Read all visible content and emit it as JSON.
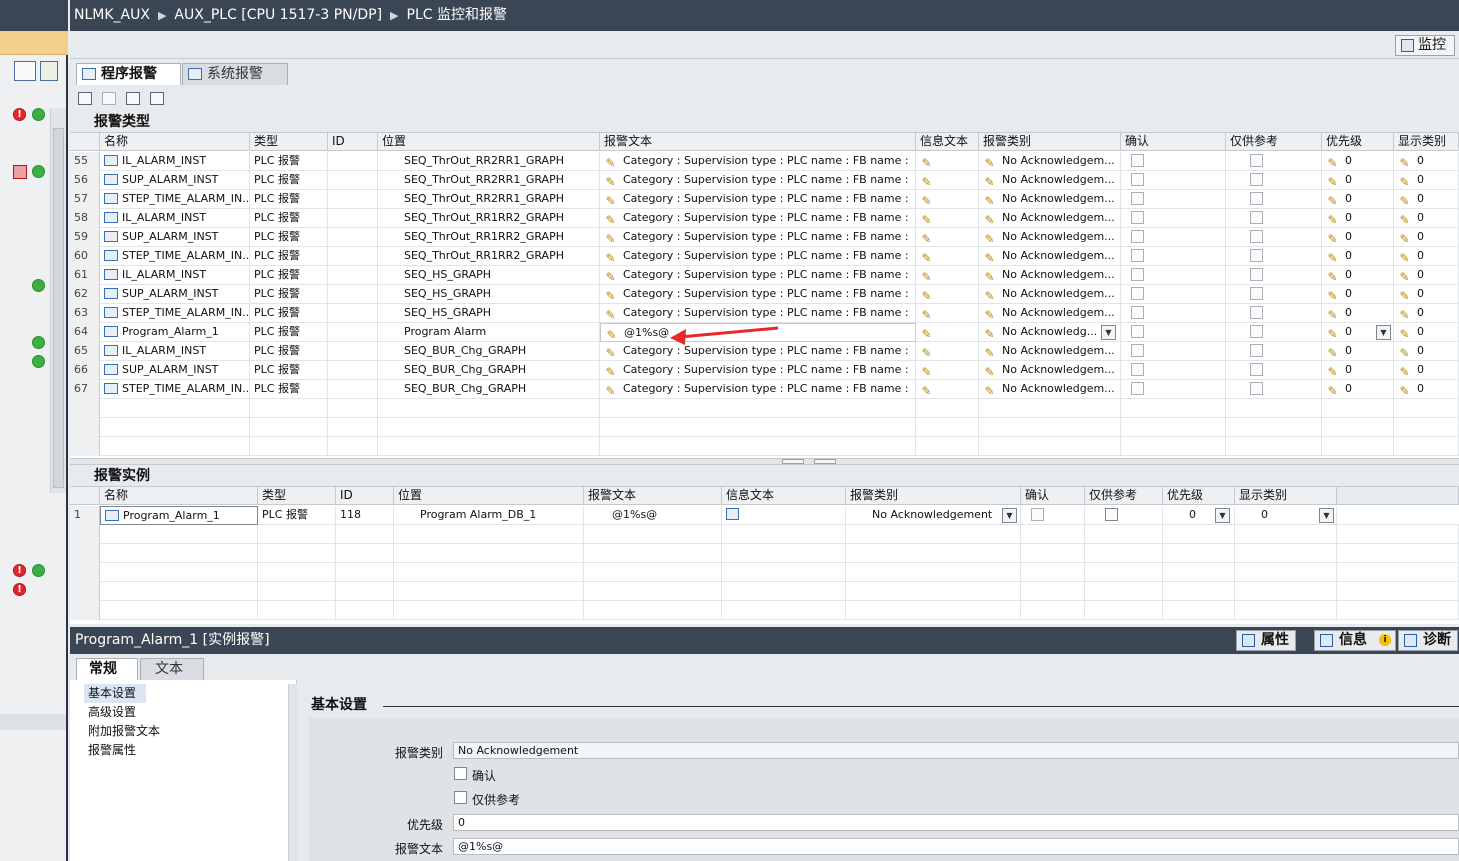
{
  "breadcrumb": {
    "project": "NLMK_AUX",
    "device": "AUX_PLC [CPU 1517-3 PN/DP]",
    "page": "PLC 监控和报警"
  },
  "toolbar": {
    "monitor_label": "监控"
  },
  "tabs": {
    "program_alarms": "程序报警",
    "system_alarms": "系统报警"
  },
  "alarm_types": {
    "section_title": "报警类型",
    "columns": [
      "名称",
      "类型",
      "ID",
      "位置",
      "报警文本",
      "信息文本",
      "报警类别",
      "确认",
      "仅供参考",
      "优先级",
      "显示类别"
    ],
    "rows": [
      {
        "n": "55",
        "name": "IL_ALARM_INST",
        "type": "PLC 报警",
        "loc": "SEQ_ThrOut_RR2RR1_GRAPH",
        "text": "Category : Supervision type : PLC name : FB name :",
        "cls": "No Acknowledgem...",
        "prio": "0",
        "disp": "0"
      },
      {
        "n": "56",
        "name": "SUP_ALARM_INST",
        "type": "PLC 报警",
        "loc": "SEQ_ThrOut_RR2RR1_GRAPH",
        "text": "Category : Supervision type : PLC name : FB name :",
        "cls": "No Acknowledgem...",
        "prio": "0",
        "disp": "0"
      },
      {
        "n": "57",
        "name": "STEP_TIME_ALARM_IN...",
        "type": "PLC 报警",
        "loc": "SEQ_ThrOut_RR2RR1_GRAPH",
        "text": "Category : Supervision type : PLC name : FB name :",
        "cls": "No Acknowledgem...",
        "prio": "0",
        "disp": "0"
      },
      {
        "n": "58",
        "name": "IL_ALARM_INST",
        "type": "PLC 报警",
        "loc": "SEQ_ThrOut_RR1RR2_GRAPH",
        "text": "Category : Supervision type : PLC name : FB name :",
        "cls": "No Acknowledgem...",
        "prio": "0",
        "disp": "0"
      },
      {
        "n": "59",
        "name": "SUP_ALARM_INST",
        "type": "PLC 报警",
        "loc": "SEQ_ThrOut_RR1RR2_GRAPH",
        "text": "Category : Supervision type : PLC name : FB name :",
        "cls": "No Acknowledgem...",
        "prio": "0",
        "disp": "0"
      },
      {
        "n": "60",
        "name": "STEP_TIME_ALARM_IN...",
        "type": "PLC 报警",
        "loc": "SEQ_ThrOut_RR1RR2_GRAPH",
        "text": "Category : Supervision type : PLC name : FB name :",
        "cls": "No Acknowledgem...",
        "prio": "0",
        "disp": "0"
      },
      {
        "n": "61",
        "name": "IL_ALARM_INST",
        "type": "PLC 报警",
        "loc": "SEQ_HS_GRAPH",
        "text": "Category : Supervision type : PLC name : FB name :",
        "cls": "No Acknowledgem...",
        "prio": "0",
        "disp": "0"
      },
      {
        "n": "62",
        "name": "SUP_ALARM_INST",
        "type": "PLC 报警",
        "loc": "SEQ_HS_GRAPH",
        "text": "Category : Supervision type : PLC name : FB name :",
        "cls": "No Acknowledgem...",
        "prio": "0",
        "disp": "0"
      },
      {
        "n": "63",
        "name": "STEP_TIME_ALARM_IN...",
        "type": "PLC 报警",
        "loc": "SEQ_HS_GRAPH",
        "text": "Category : Supervision type : PLC name : FB name :",
        "cls": "No Acknowledgem...",
        "prio": "0",
        "disp": "0"
      },
      {
        "n": "64",
        "name": "Program_Alarm_1",
        "type": "PLC 报警",
        "loc": "Program Alarm",
        "text": "@1%s@",
        "cls": "No Acknowledg...",
        "prio": "0",
        "disp": "0",
        "selected": true
      },
      {
        "n": "65",
        "name": "IL_ALARM_INST",
        "type": "PLC 报警",
        "loc": "SEQ_BUR_Chg_GRAPH",
        "text": "Category : Supervision type : PLC name : FB name :",
        "cls": "No Acknowledgem...",
        "prio": "0",
        "disp": "0"
      },
      {
        "n": "66",
        "name": "SUP_ALARM_INST",
        "type": "PLC 报警",
        "loc": "SEQ_BUR_Chg_GRAPH",
        "text": "Category : Supervision type : PLC name : FB name :",
        "cls": "No Acknowledgem...",
        "prio": "0",
        "disp": "0"
      },
      {
        "n": "67",
        "name": "STEP_TIME_ALARM_IN...",
        "type": "PLC 报警",
        "loc": "SEQ_BUR_Chg_GRAPH",
        "text": "Category : Supervision type : PLC name : FB name :",
        "cls": "No Acknowledgem...",
        "prio": "0",
        "disp": "0"
      }
    ]
  },
  "alarm_instances": {
    "section_title": "报警实例",
    "columns": [
      "名称",
      "类型",
      "ID",
      "位置",
      "报警文本",
      "信息文本",
      "报警类别",
      "确认",
      "仅供参考",
      "优先级",
      "显示类别"
    ],
    "rows": [
      {
        "n": "1",
        "name": "Program_Alarm_1",
        "type": "PLC 报警",
        "id": "118",
        "loc": "Program Alarm_DB_1",
        "text": "@1%s@",
        "cls": "No Acknowledgement",
        "prio": "0",
        "disp": "0"
      }
    ]
  },
  "inspector": {
    "title": "Program_Alarm_1 [实例报警]",
    "right_tabs": [
      "属性",
      "信息",
      "诊断"
    ],
    "tabs": [
      "常规",
      "文本"
    ],
    "nav": [
      "基本设置",
      "高级设置",
      "附加报警文本",
      "报警属性"
    ],
    "section": "基本设置",
    "fields": {
      "class_label": "报警类别",
      "class_value": "No Acknowledgement",
      "ack_label": "确认",
      "info_label": "仅供参考",
      "prio_label": "优先级",
      "prio_value": "0",
      "text_label": "报警文本",
      "text_value": "@1%s@"
    }
  },
  "colors": {
    "titlebar": "#3b4655",
    "arrow": "#e8282b",
    "ok": "#3cb043",
    "error": "#e0262b"
  }
}
